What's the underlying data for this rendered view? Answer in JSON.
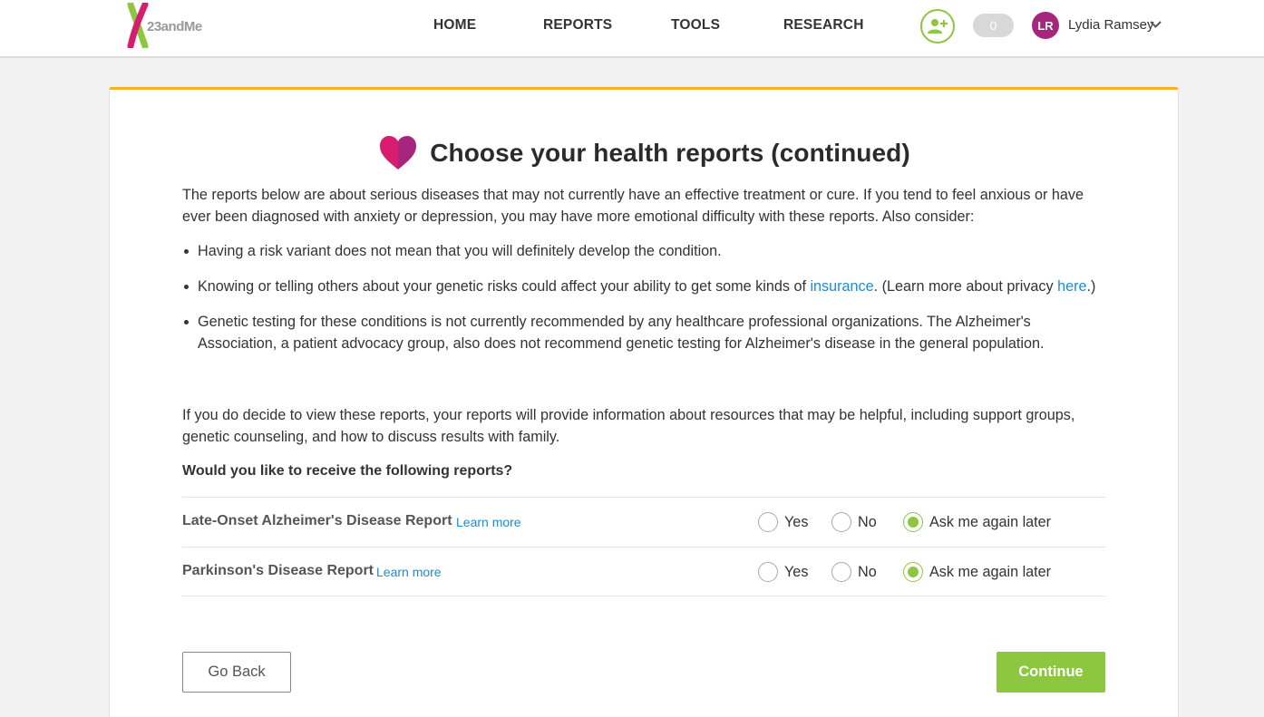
{
  "brand": {
    "logo_text": "23andMe",
    "accent_green": "#8dc63f",
    "accent_purple": "#a6267e",
    "accent_yellow": "#f5b324",
    "link_blue": "#1f8ccd"
  },
  "nav": {
    "items": [
      {
        "label": "HOME"
      },
      {
        "label": "REPORTS"
      },
      {
        "label": "TOOLS"
      },
      {
        "label": "RESEARCH"
      }
    ]
  },
  "header": {
    "notification_count": "0",
    "avatar_initials": "LR",
    "user_name": "Lydia Ramsey",
    "add_person_icon": "add-person-icon",
    "chevron_icon": "chevron-down-icon"
  },
  "page": {
    "title": "Choose your health reports (continued)",
    "heart_icon": "heart-icon",
    "intro": "The reports below are about serious diseases that may not currently have an effective treatment or cure. If you tend to feel anxious or have ever been diagnosed with anxiety or depression, you may have more emotional difficulty with these reports. Also consider:",
    "bullets": {
      "b1": "Having a risk variant does not mean that you will definitely develop the condition.",
      "b2_pre": "Knowing or telling others about your genetic risks could affect your ability to get some kinds of ",
      "b2_link1": "insurance",
      "b2_mid": ". (Learn more about privacy ",
      "b2_link2": "here",
      "b2_post": ".)",
      "b3": "Genetic testing for these conditions is not currently recommended by any healthcare professional organizations. The Alzheimer's Association, a patient advocacy group, also does not recommend genetic testing for Alzheimer's disease in the general population."
    },
    "resources": "If you do decide to view these reports, your reports will provide information about resources that may be helpful, including support groups, genetic counseling, and how to discuss results with family.",
    "question": "Would you like to receive the following reports?",
    "reports": [
      {
        "name": "Late-Onset Alzheimer's Disease Report",
        "learn_more": "Learn more",
        "options": [
          "Yes",
          "No",
          "Ask me again later"
        ],
        "selected": "Ask me again later"
      },
      {
        "name": "Parkinson's Disease Report",
        "learn_more": "Learn more",
        "options": [
          "Yes",
          "No",
          "Ask me again later"
        ],
        "selected": "Ask me again later"
      }
    ],
    "buttons": {
      "back": "Go Back",
      "continue": "Continue"
    }
  }
}
